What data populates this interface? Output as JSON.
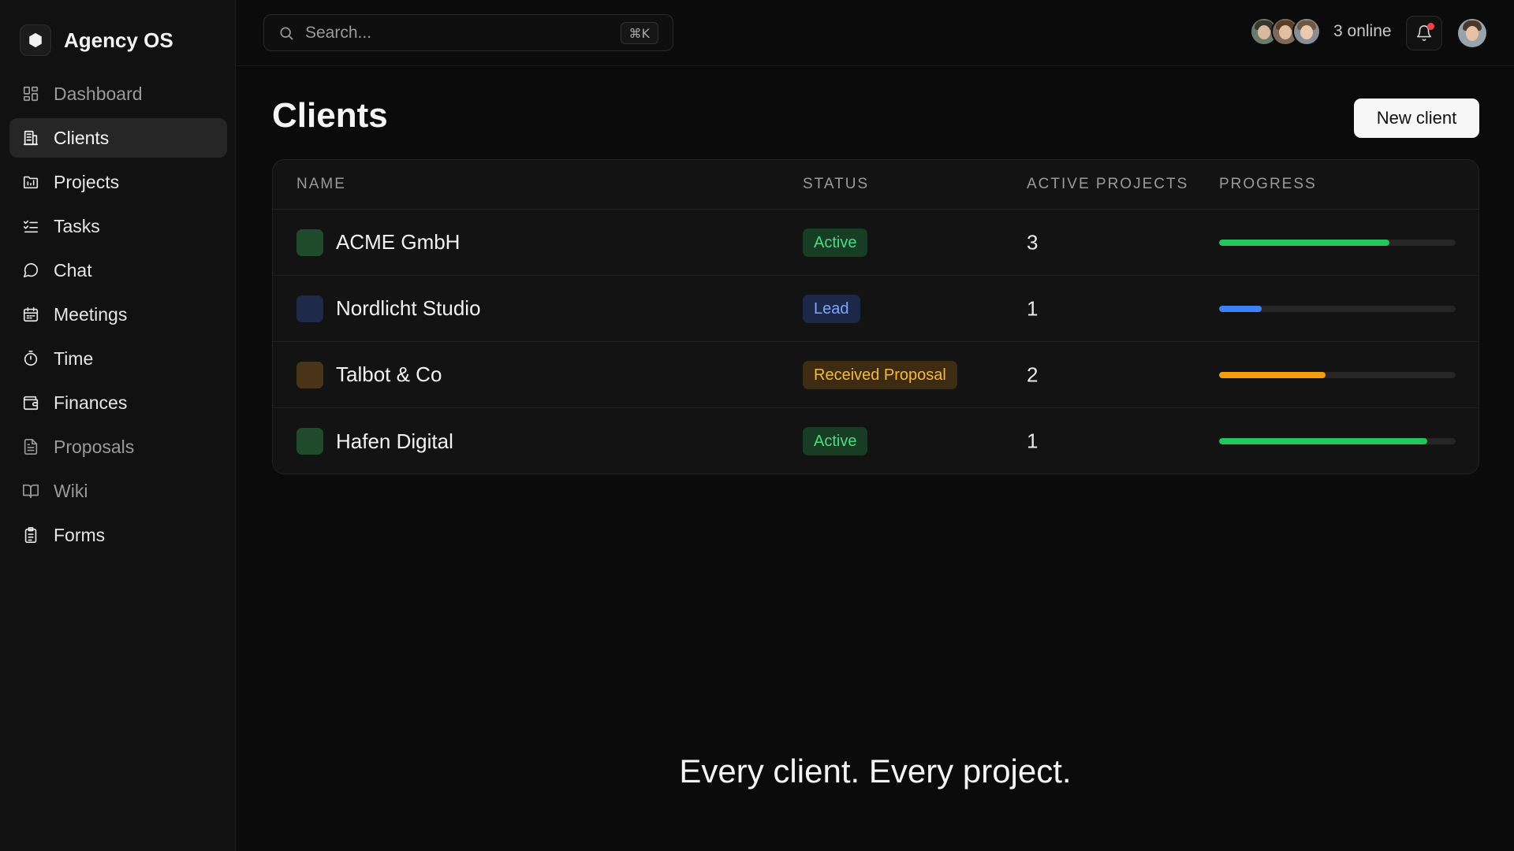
{
  "app": {
    "name": "Agency OS"
  },
  "sidebar": {
    "items": [
      {
        "label": "Dashboard",
        "icon": "dashboard-icon",
        "state": "muted"
      },
      {
        "label": "Clients",
        "icon": "clients-icon",
        "state": "active"
      },
      {
        "label": "Projects",
        "icon": "projects-icon",
        "state": "normal"
      },
      {
        "label": "Tasks",
        "icon": "tasks-icon",
        "state": "normal"
      },
      {
        "label": "Chat",
        "icon": "chat-icon",
        "state": "normal"
      },
      {
        "label": "Meetings",
        "icon": "calendar-icon",
        "state": "normal"
      },
      {
        "label": "Time",
        "icon": "stopwatch-icon",
        "state": "normal"
      },
      {
        "label": "Finances",
        "icon": "wallet-icon",
        "state": "normal"
      },
      {
        "label": "Proposals",
        "icon": "document-icon",
        "state": "muted"
      },
      {
        "label": "Wiki",
        "icon": "book-icon",
        "state": "muted"
      },
      {
        "label": "Forms",
        "icon": "clipboard-icon",
        "state": "normal"
      }
    ]
  },
  "topbar": {
    "search_placeholder": "Search...",
    "shortcut": "⌘K",
    "online_text": "3 online",
    "notification_dot_color": "#ef4444"
  },
  "main": {
    "title": "Clients",
    "new_button": "New client",
    "columns": {
      "name": "NAME",
      "status": "STATUS",
      "projects": "ACTIVE PROJECTS",
      "progress": "PROGRESS"
    },
    "clients": [
      {
        "name": "ACME GmbH",
        "status": "Active",
        "active_projects": "3",
        "progress": 0.72,
        "swatch": "#1f4a2b",
        "badge_bg": "#173d24",
        "badge_fg": "#4ade80",
        "bar_color": "#22c55e"
      },
      {
        "name": "Nordlicht Studio",
        "status": "Lead",
        "active_projects": "1",
        "progress": 0.18,
        "swatch": "#1e2a4a",
        "badge_bg": "#1b2847",
        "badge_fg": "#7fa6ff",
        "bar_color": "#3b82f6"
      },
      {
        "name": "Talbot & Co",
        "status": "Received Proposal",
        "active_projects": "2",
        "progress": 0.45,
        "swatch": "#4a3418",
        "badge_bg": "#3d2c12",
        "badge_fg": "#f5b942",
        "bar_color": "#f59e0b"
      },
      {
        "name": "Hafen Digital",
        "status": "Active",
        "active_projects": "1",
        "progress": 0.88,
        "swatch": "#1f4a2b",
        "badge_bg": "#173d24",
        "badge_fg": "#4ade80",
        "bar_color": "#22c55e"
      }
    ]
  },
  "tagline": "Every client. Every project."
}
